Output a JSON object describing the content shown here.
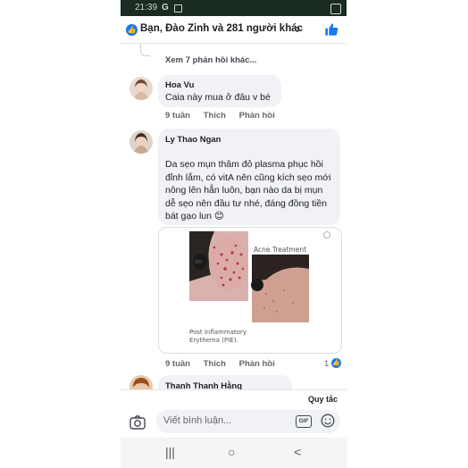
{
  "status_bar": {
    "time": "21:39",
    "g_label": "G"
  },
  "header": {
    "reactions_text": "Bạn, Đào Zinh và 281 người khác"
  },
  "feed": {
    "more_replies": "Xem 7 phản hồi khác...",
    "comments": [
      {
        "author": "Hoa Vu",
        "text": "Caia này mua ở đâu v bé",
        "time": "9 tuần",
        "like_label": "Thích",
        "reply_label": "Phản hồi"
      },
      {
        "author": "Ly Thao Ngan",
        "text": "Da sẹo mụn thâm đỏ plasma phục hồi đỉnh lắm, có vitA nên cũng kích sẹo mới nông lên hẳn luôn, bạn nào da bị mụn dễ sẹo nên đầu tư nhé, đáng đồng tiền bát gạo lun 😊",
        "time": "9 tuần",
        "like_label": "Thích",
        "reply_label": "Phản hồi",
        "like_count": "1",
        "photo": {
          "left_caption": "Post Inflammatory Erythema (PIE).",
          "right_caption": "Acne Treatment"
        }
      },
      {
        "author": "Thanh Thanh Hằng"
      }
    ]
  },
  "composer": {
    "rules_label": "Quy tắc",
    "placeholder": "Viết bình luận...",
    "gif_label": "GIF"
  },
  "nav": {
    "recent": "|||",
    "home": "○",
    "back": "<"
  },
  "colors": {
    "accent": "#1877f2",
    "bubble": "#f0f2f5",
    "status_bar": "#1a2b22"
  }
}
